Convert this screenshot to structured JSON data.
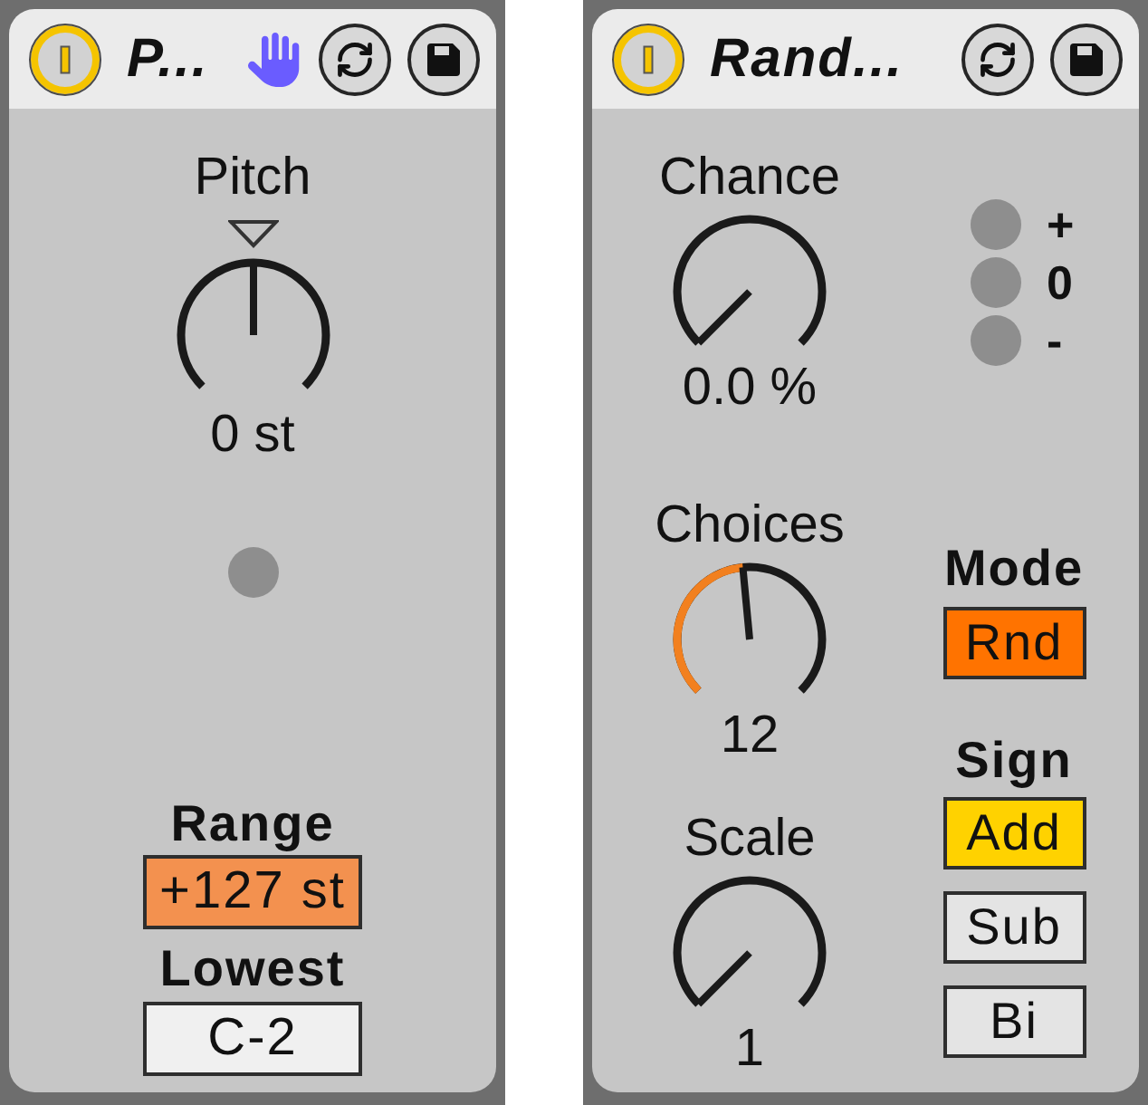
{
  "devices": [
    {
      "kind": "pitch",
      "title": "P...",
      "on": true,
      "header_buttons": [
        {
          "kind": "hand"
        },
        {
          "kind": "swap"
        },
        {
          "kind": "save"
        }
      ],
      "knobs": [
        {
          "kind": "bipolar",
          "label": "Pitch",
          "reading": "0 st",
          "level": 0.5
        }
      ],
      "indicators": [
        {
          "on": false
        }
      ],
      "fields": [
        {
          "label": "Range",
          "value": "+127 st",
          "highlighted": true
        },
        {
          "label": "Lowest",
          "value": "C-2",
          "highlighted": false
        }
      ]
    },
    {
      "kind": "random",
      "title": "Rand...",
      "on": true,
      "header_buttons": [
        {
          "kind": "swap"
        },
        {
          "kind": "save"
        }
      ],
      "knobs": [
        {
          "kind": "unipolar",
          "label": "Chance",
          "reading": "0.0 %",
          "level": 0
        },
        {
          "kind": "unipolar",
          "label": "Choices",
          "reading": "12",
          "level": 0.48
        },
        {
          "kind": "unipolar",
          "label": "Scale",
          "reading": "1",
          "level": 0
        }
      ],
      "indicators": [
        {
          "label": "+",
          "on": false
        },
        {
          "label": "0",
          "on": false
        },
        {
          "label": "-",
          "on": false
        }
      ],
      "mode": {
        "label": "Mode",
        "button": {
          "text": "Rnd",
          "on": true
        }
      },
      "sign": {
        "label": "Sign",
        "options": [
          {
            "text": "Add",
            "selected": true
          },
          {
            "text": "Sub",
            "selected": false
          },
          {
            "text": "Bi",
            "selected": false
          }
        ]
      }
    }
  ]
}
